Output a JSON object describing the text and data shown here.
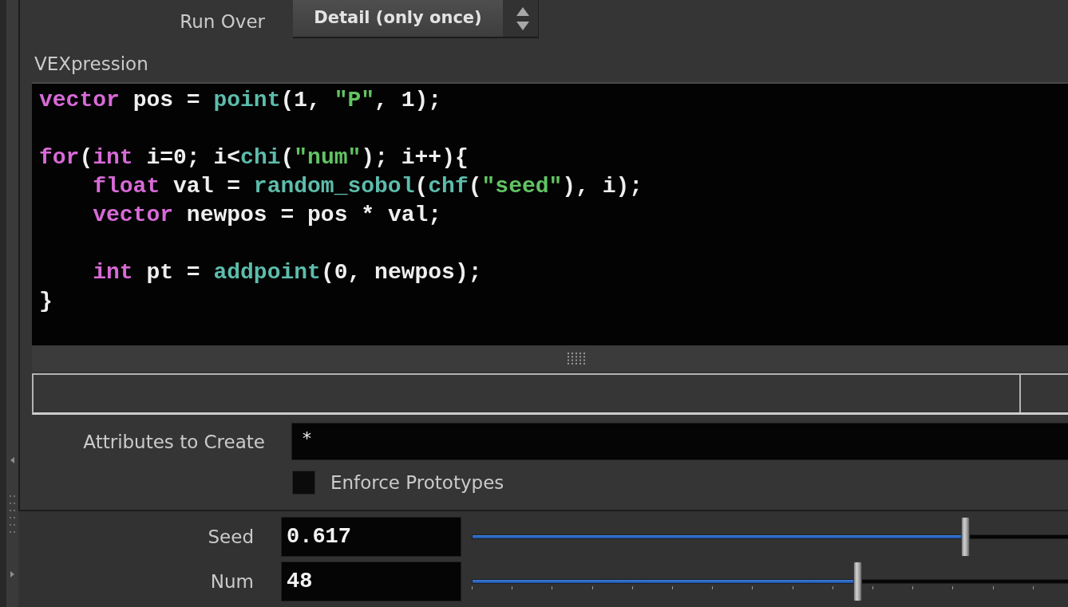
{
  "run_over": {
    "label": "Run Over",
    "value": "Detail (only once)"
  },
  "vexpression": {
    "label": "VEXpression",
    "lines": [
      {
        "kind": "code",
        "tokens": [
          {
            "kind": "keyword",
            "text": "vector"
          },
          {
            "kind": "plain",
            "text": " pos = "
          },
          {
            "kind": "function",
            "text": "point"
          },
          {
            "kind": "plain",
            "text": "(1, "
          },
          {
            "kind": "string",
            "text": "\"P\""
          },
          {
            "kind": "plain",
            "text": ", 1);"
          }
        ]
      },
      {
        "kind": "blank"
      },
      {
        "kind": "code",
        "tokens": [
          {
            "kind": "keyword",
            "text": "for"
          },
          {
            "kind": "plain",
            "text": "("
          },
          {
            "kind": "keyword",
            "text": "int"
          },
          {
            "kind": "plain",
            "text": " i=0; i<"
          },
          {
            "kind": "function",
            "text": "chi"
          },
          {
            "kind": "plain",
            "text": "("
          },
          {
            "kind": "string",
            "text": "\"num\""
          },
          {
            "kind": "plain",
            "text": "); i++){"
          }
        ],
        "children": [
          {
            "kind": "code",
            "tokens": [
              {
                "kind": "keyword",
                "text": "float"
              },
              {
                "kind": "plain",
                "text": " val = "
              },
              {
                "kind": "function",
                "text": "random_sobol"
              },
              {
                "kind": "plain",
                "text": "("
              },
              {
                "kind": "function",
                "text": "chf"
              },
              {
                "kind": "plain",
                "text": "("
              },
              {
                "kind": "string",
                "text": "\"seed\""
              },
              {
                "kind": "plain",
                "text": "), i);"
              }
            ]
          },
          {
            "kind": "code",
            "tokens": [
              {
                "kind": "keyword",
                "text": "vector"
              },
              {
                "kind": "plain",
                "text": " newpos = pos * val;"
              }
            ]
          },
          {
            "kind": "blank"
          },
          {
            "kind": "code",
            "tokens": [
              {
                "kind": "keyword",
                "text": "int"
              },
              {
                "kind": "plain",
                "text": " pt = "
              },
              {
                "kind": "function",
                "text": "addpoint"
              },
              {
                "kind": "plain",
                "text": "(0, newpos);"
              }
            ]
          }
        ]
      },
      {
        "kind": "code",
        "tokens": [
          {
            "kind": "plain",
            "text": "}"
          }
        ]
      }
    ]
  },
  "attributes_to_create": {
    "label": "Attributes to Create",
    "value": "*"
  },
  "enforce_prototypes": {
    "label": "Enforce Prototypes",
    "checked": false
  },
  "sliders": [
    {
      "label": "Seed",
      "value": "0.617",
      "level": 0.82,
      "ticks": false
    },
    {
      "label": "Num",
      "value": "48",
      "level": 0.64,
      "ticks": true
    }
  ]
}
